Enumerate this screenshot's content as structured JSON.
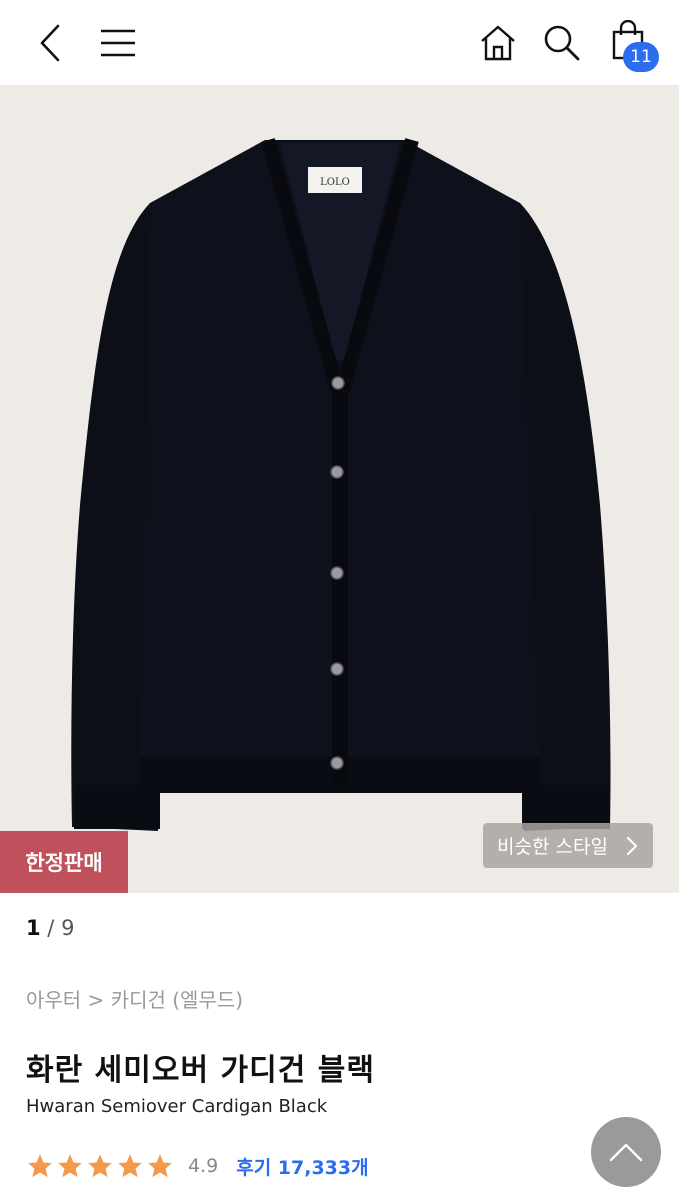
{
  "header": {
    "cart_count": "11"
  },
  "hero": {
    "limited_badge": "한정판매",
    "similar_style_label": "비슷한 스타일",
    "brand_tag": "LOLO"
  },
  "pager": {
    "current": "1",
    "separator": " / ",
    "total": "9"
  },
  "product": {
    "breadcrumb": "아우터 > 카디건 (엘무드)",
    "title": "화란 세미오버 가디건 블랙",
    "subtitle": "Hwaran Semiover Cardigan Black",
    "rating": "4.9",
    "stars": 5,
    "reviews": "후기 17,333개"
  },
  "colors": {
    "accent": "#2b6cf0",
    "limited": "#c0505c",
    "star": "#f2994a"
  }
}
